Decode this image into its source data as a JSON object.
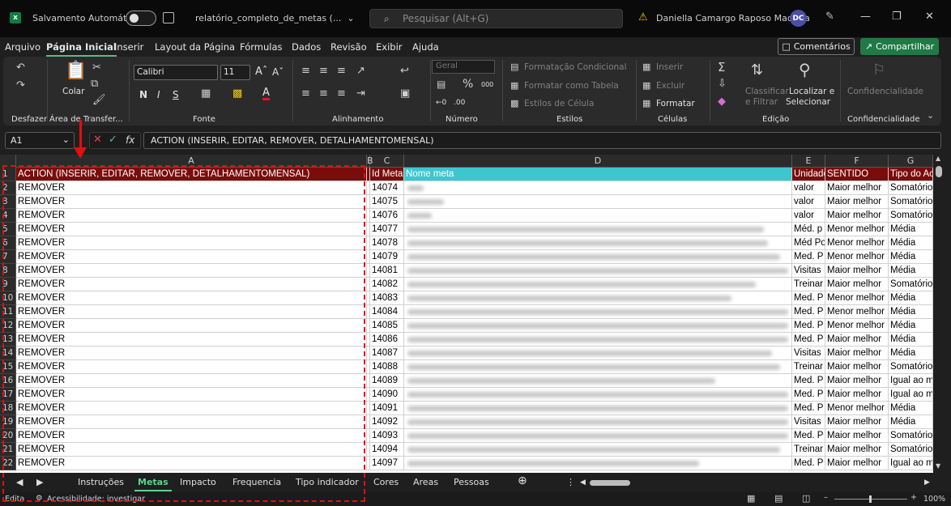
{
  "title_bar": {
    "autosave_label": "Salvamento Automático",
    "filename": "relatório_completo_de_metas (...",
    "filename_chevron": "⌄",
    "search_placeholder": "Pesquisar (Alt+G)",
    "user_name": "Daniella Camargo Raposo Madeira",
    "user_initials": "DC"
  },
  "menu": {
    "tabs": [
      "Arquivo",
      "Página Inicial",
      "Inserir",
      "Layout da Página",
      "Fórmulas",
      "Dados",
      "Revisão",
      "Exibir",
      "Ajuda"
    ],
    "active_tab": "Página Inicial",
    "comments_label": "Comentários",
    "share_label": "Compartilhar"
  },
  "ribbon": {
    "undo_group_label": "Desfazer",
    "paste_label": "Colar",
    "clipboard_group_label": "Área de Transfer...",
    "font_name": "Calibri",
    "font_size": "11",
    "font_group_label": "Fonte",
    "alignment_group_label": "Alinhamento",
    "number_format": "Geral",
    "number_group_label": "Número",
    "conditional_format": "Formatação Condicional",
    "format_as_table": "Formatar como Tabela",
    "cell_styles": "Estilos de Célula",
    "styles_group_label": "Estilos",
    "insert_label": "Inserir",
    "delete_label": "Excluir",
    "format_label": "Formatar",
    "cells_group_label": "Células",
    "sort_filter_line1": "Classificar",
    "sort_filter_line2": "e Filtrar",
    "find_select_line1": "Localizar e",
    "find_select_line2": "Selecionar",
    "editing_group_label": "Edição",
    "sensitivity_label": "Confidencialidade",
    "sensitivity_group_label": "Confidencialidade"
  },
  "formula_bar": {
    "name_box": "A1",
    "formula": "ACTION (INSERIR, EDITAR, REMOVER, DETALHAMENTOMENSAL)"
  },
  "columns": [
    "A",
    "B",
    "C",
    "D",
    "E",
    "F",
    "G"
  ],
  "header_row": {
    "row_number": "1",
    "a": "ACTION (INSERIR, EDITAR, REMOVER, DETALHAMENTOMENSAL)",
    "c": "Id Meta",
    "d": "Nome meta",
    "e": "Unidade",
    "f": "SENTIDO",
    "g": "Tipo do Acumulado"
  },
  "rows": [
    {
      "n": "2",
      "a": "REMOVER",
      "c": "14074",
      "e": "valor",
      "f": "Maior melhor",
      "g": "Somatório"
    },
    {
      "n": "3",
      "a": "REMOVER",
      "c": "14075",
      "e": "valor",
      "f": "Maior melhor",
      "g": "Somatório"
    },
    {
      "n": "4",
      "a": "REMOVER",
      "c": "14076",
      "e": "valor",
      "f": "Maior melhor",
      "g": "Somatório"
    },
    {
      "n": "5",
      "a": "REMOVER",
      "c": "14077",
      "e": "Méd. p",
      "f": "Menor melhor",
      "g": "Média"
    },
    {
      "n": "6",
      "a": "REMOVER",
      "c": "14078",
      "e": "Méd Po",
      "f": "Menor melhor",
      "g": "Média"
    },
    {
      "n": "7",
      "a": "REMOVER",
      "c": "14079",
      "e": "Med. P",
      "f": "Menor melhor",
      "g": "Média"
    },
    {
      "n": "8",
      "a": "REMOVER",
      "c": "14081",
      "e": "Visitas",
      "f": "Maior melhor",
      "g": "Média"
    },
    {
      "n": "9",
      "a": "REMOVER",
      "c": "14082",
      "e": "Treinar",
      "f": "Maior melhor",
      "g": "Somatório"
    },
    {
      "n": "10",
      "a": "REMOVER",
      "c": "14083",
      "e": "Med. P",
      "f": "Menor melhor",
      "g": "Média"
    },
    {
      "n": "11",
      "a": "REMOVER",
      "c": "14084",
      "e": "Med. P",
      "f": "Menor melhor",
      "g": "Média"
    },
    {
      "n": "12",
      "a": "REMOVER",
      "c": "14085",
      "e": "Med. P",
      "f": "Menor melhor",
      "g": "Média"
    },
    {
      "n": "13",
      "a": "REMOVER",
      "c": "14086",
      "e": "Med. P",
      "f": "Maior melhor",
      "g": "Média"
    },
    {
      "n": "14",
      "a": "REMOVER",
      "c": "14087",
      "e": "Visitas",
      "f": "Maior melhor",
      "g": "Média"
    },
    {
      "n": "15",
      "a": "REMOVER",
      "c": "14088",
      "e": "Treinar",
      "f": "Maior melhor",
      "g": "Somatório"
    },
    {
      "n": "16",
      "a": "REMOVER",
      "c": "14089",
      "e": "Med. P",
      "f": "Maior melhor",
      "g": "Igual ao m"
    },
    {
      "n": "17",
      "a": "REMOVER",
      "c": "14090",
      "e": "Med. P",
      "f": "Maior melhor",
      "g": "Igual ao m"
    },
    {
      "n": "18",
      "a": "REMOVER",
      "c": "14091",
      "e": "Med. P",
      "f": "Menor melhor",
      "g": "Média"
    },
    {
      "n": "19",
      "a": "REMOVER",
      "c": "14092",
      "e": "Visitas",
      "f": "Maior melhor",
      "g": "Média"
    },
    {
      "n": "20",
      "a": "REMOVER",
      "c": "14093",
      "e": "Med. P",
      "f": "Maior melhor",
      "g": "Somatório"
    },
    {
      "n": "21",
      "a": "REMOVER",
      "c": "14094",
      "e": "Treinar",
      "f": "Maior melhor",
      "g": "Somatório"
    },
    {
      "n": "22",
      "a": "REMOVER",
      "c": "14097",
      "e": "Med. P",
      "f": "Maior melhor",
      "g": "Igual ao m"
    }
  ],
  "sheet_tabs": [
    "Instruções",
    "Metas",
    "Impacto",
    "Frequencia",
    "Tipo indicador",
    "Cores",
    "Areas",
    "Pessoas"
  ],
  "active_sheet": "Metas",
  "status": {
    "mode": "Edita",
    "accessibility": "Acessibilidade: investigar",
    "zoom": "100%"
  },
  "colors": {
    "excel_green": "#107c41",
    "header_dark_red": "#7b0c0c",
    "header_cyan": "#3cc7cf",
    "annotation_red": "#e01010"
  }
}
